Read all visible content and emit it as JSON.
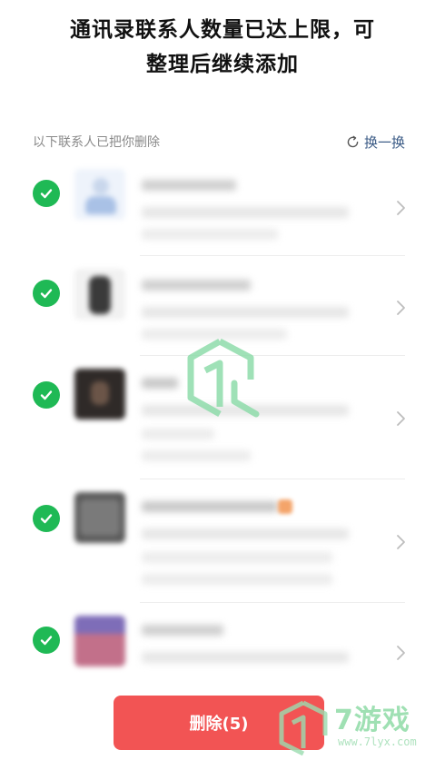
{
  "header": {
    "line1": "通讯录联系人数量已达上限，可",
    "line2": "整理后继续添加"
  },
  "subbar": {
    "label": "以下联系人已把你删除",
    "refresh_label": "换一换",
    "refresh_icon": "refresh-icon"
  },
  "contacts": [
    {
      "checked": true,
      "name_visible": false
    },
    {
      "checked": true,
      "name_visible": false
    },
    {
      "checked": true,
      "name_visible": false
    },
    {
      "checked": true,
      "name_visible": false
    },
    {
      "checked": true,
      "name_visible": false
    }
  ],
  "delete_button": {
    "label": "删除(5)"
  },
  "brand": {
    "name": "7游戏",
    "url": "www.7lyx.com"
  },
  "colors": {
    "check": "#1fb955",
    "delete": "#f25454",
    "link": "#3b5b86",
    "watermark": "#7fd69a"
  }
}
